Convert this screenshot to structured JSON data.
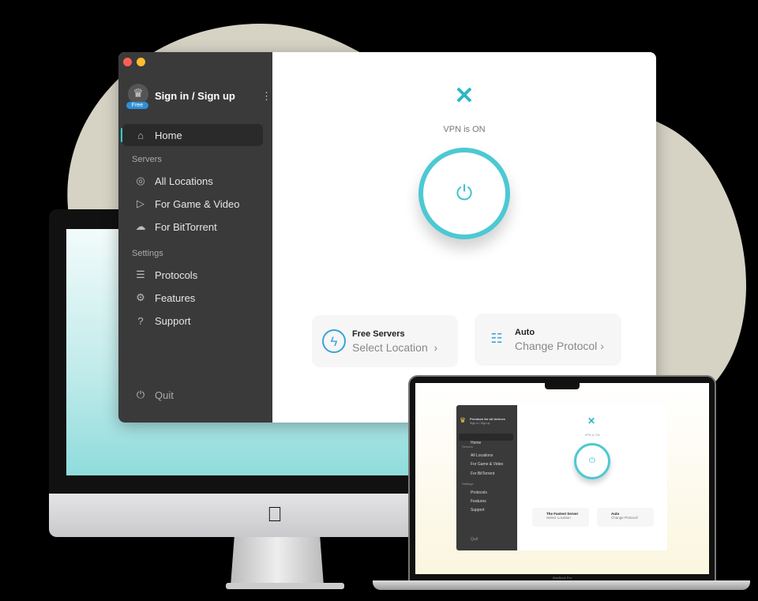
{
  "colors": {
    "accent": "#4cc9d3",
    "free_badge": "#2e8fd8",
    "sidebar_bg": "#3a3a3b",
    "blob": "#d6d3c5"
  },
  "app": {
    "account": {
      "label": "Sign in / Sign up",
      "badge": "Free",
      "menu_icon": "kebab-icon"
    },
    "nav": {
      "home": "Home",
      "servers_heading": "Servers",
      "servers": [
        "All Locations",
        "For Game & Video",
        "For BitTorrent"
      ],
      "settings_heading": "Settings",
      "settings": [
        "Protocols",
        "Features",
        "Support"
      ],
      "quit": "Quit"
    },
    "status": "VPN is ON",
    "cards": [
      {
        "title": "Free Servers",
        "subtitle": "Select Location",
        "icon": "lightning-icon"
      },
      {
        "title": "Auto",
        "subtitle": "Change Protocol",
        "icon": "toggle-icon"
      }
    ]
  },
  "laptop": {
    "brand_label": "MacBook Pro",
    "account": {
      "title": "Premium for all devices",
      "subtitle": "Sign in / Sign up"
    },
    "nav": {
      "home": "Home",
      "servers_heading": "Servers",
      "servers": [
        "All Locations",
        "For Game & Video",
        "For BitTorrent"
      ],
      "settings_heading": "Settings",
      "settings": [
        "Protocols",
        "Features",
        "Support"
      ],
      "quit": "Quit"
    },
    "status": "VPN is ON",
    "cards": [
      {
        "title": "The Fastest Server",
        "subtitle": "Select Location"
      },
      {
        "title": "Auto",
        "subtitle": "Change Protocol"
      }
    ]
  }
}
